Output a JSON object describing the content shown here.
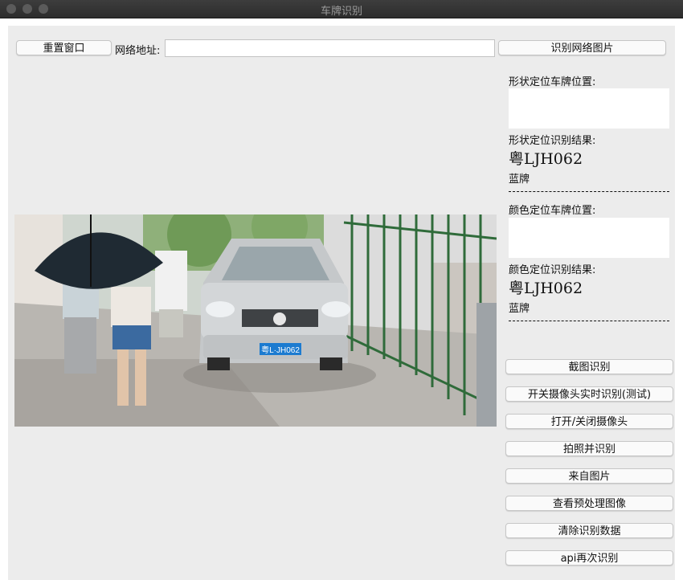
{
  "window": {
    "title": "车牌识别"
  },
  "toolbar": {
    "reset_label": "重置窗口",
    "url_label": "网络地址:",
    "url_value": "",
    "recognize_url_label": "识别网络图片"
  },
  "shape": {
    "position_label": "形状定位车牌位置:",
    "result_label": "形状定位识别结果:",
    "result_value": "粤LJH062",
    "plate_color": "蓝牌"
  },
  "color": {
    "position_label": "颜色定位车牌位置:",
    "result_label": "颜色定位识别结果:",
    "result_value": "粤LJH062",
    "plate_color": "蓝牌"
  },
  "divider_text": "------------------------------",
  "image": {
    "plate_text": "粤L·JH062"
  },
  "actions": [
    "截图识别",
    "开关摄像头实时识别(测试)",
    "打开/关闭摄像头",
    "拍照并识别",
    "来自图片",
    "查看预处理图像",
    "清除识别数据",
    "api再次识别"
  ],
  "colors": {
    "panel": "#ececec",
    "plate_blue": "#1c7bd0"
  }
}
